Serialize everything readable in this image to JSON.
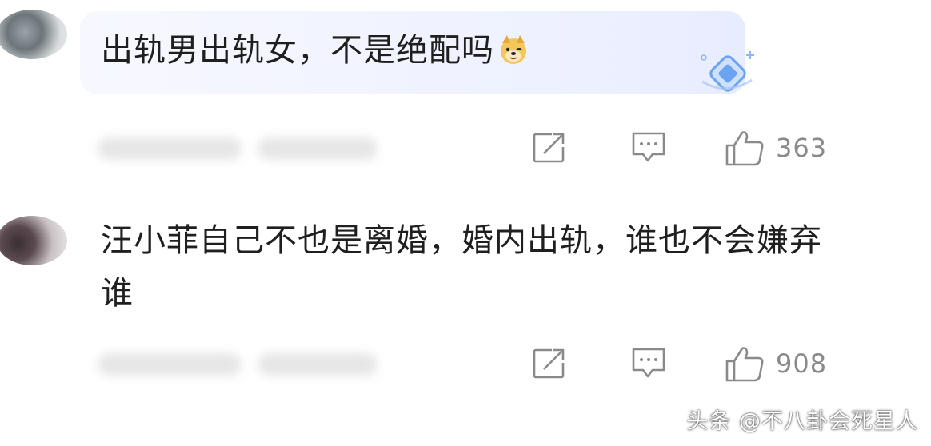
{
  "comments": [
    {
      "text": "出轨男出轨女，不是绝配吗",
      "emoji": "doge-emoji",
      "likes": "363"
    },
    {
      "text": "汪小菲自己不也是离婚，婚内出轨，谁也不会嫌弃谁",
      "likes": "908"
    }
  ],
  "watermark": "头条 @不八卦会死星人",
  "icons": {
    "share": "share-icon",
    "comment": "comment-icon",
    "like": "thumbs-up-icon"
  },
  "colors": {
    "icon_gray": "#8a8a8a",
    "bubble_bg": "#eef1ff",
    "gem_blue": "#6aa3f2"
  }
}
